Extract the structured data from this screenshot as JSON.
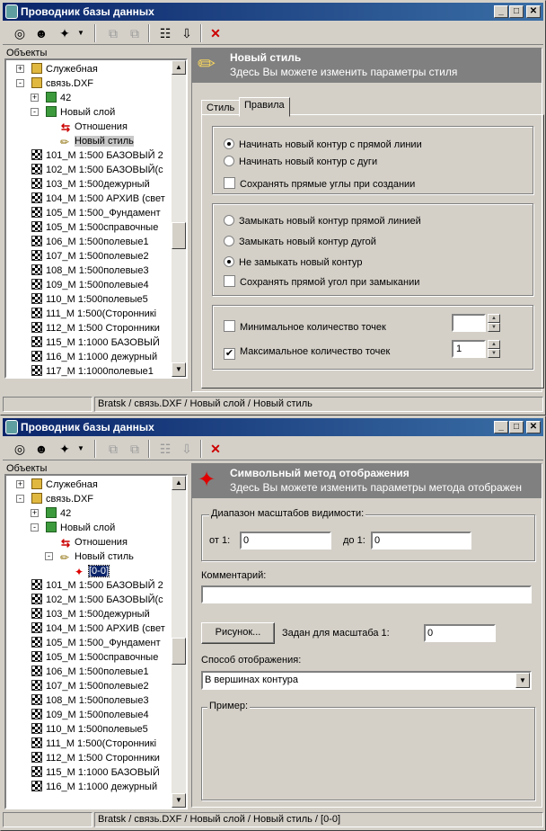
{
  "window_title": "Проводник базы данных",
  "objects_label": "Объекты",
  "toolbar_icons": [
    "connect-icon",
    "open-icon",
    "new-icon",
    "dropdown-icon",
    "copy-icon",
    "paste-icon",
    "properties-icon",
    "import-icon",
    "delete-icon"
  ],
  "top": {
    "tree": {
      "rows": [
        {
          "label": "Служебная",
          "icon": "folder",
          "level": 1,
          "exp": "+"
        },
        {
          "label": "связь.DXF",
          "icon": "folder",
          "level": 1,
          "exp": "-"
        },
        {
          "label": "42",
          "icon": "layer",
          "level": 2,
          "exp": "+"
        },
        {
          "label": "Новый слой",
          "icon": "layer",
          "level": 2,
          "exp": "-"
        },
        {
          "label": "Отношения",
          "icon": "rel",
          "level": 3,
          "exp": ""
        },
        {
          "label": "Новый стиль",
          "icon": "pen",
          "level": 3,
          "exp": "",
          "sel": true
        },
        {
          "label": "101_М 1:500 БАЗОВЫЙ 2",
          "icon": "net",
          "level": 1,
          "exp": ""
        },
        {
          "label": "102_М 1:500 БАЗОВЫЙ(с",
          "icon": "net",
          "level": 1,
          "exp": ""
        },
        {
          "label": "103_М 1:500дежурный",
          "icon": "net",
          "level": 1,
          "exp": ""
        },
        {
          "label": "104_М 1:500 АРХИВ (свет",
          "icon": "net",
          "level": 1,
          "exp": ""
        },
        {
          "label": "105_М 1:500_Фундамент",
          "icon": "net",
          "level": 1,
          "exp": ""
        },
        {
          "label": "105_М 1:500справочные",
          "icon": "net",
          "level": 1,
          "exp": ""
        },
        {
          "label": "106_М 1:500полевые1",
          "icon": "net",
          "level": 1,
          "exp": ""
        },
        {
          "label": "107_М 1:500полевые2",
          "icon": "net",
          "level": 1,
          "exp": ""
        },
        {
          "label": "108_М 1:500полевые3",
          "icon": "net",
          "level": 1,
          "exp": ""
        },
        {
          "label": "109_М 1:500полевые4",
          "icon": "net",
          "level": 1,
          "exp": ""
        },
        {
          "label": "110_М 1:500полевые5",
          "icon": "net",
          "level": 1,
          "exp": ""
        },
        {
          "label": "111_М 1:500(Сторонникі",
          "icon": "net",
          "level": 1,
          "exp": ""
        },
        {
          "label": "112_М 1:500 Сторонники",
          "icon": "net",
          "level": 1,
          "exp": ""
        },
        {
          "label": "115_М 1:1000 БАЗОВЫЙ",
          "icon": "net",
          "level": 1,
          "exp": ""
        },
        {
          "label": "116_М 1:1000 дежурный",
          "icon": "net",
          "level": 1,
          "exp": ""
        },
        {
          "label": "117_М 1:1000полевые1",
          "icon": "net",
          "level": 1,
          "exp": ""
        }
      ]
    },
    "header": {
      "title": "Новый стиль",
      "subtitle": "Здесь Вы можете изменить параметры стиля"
    },
    "tabs": [
      "Стиль",
      "Правила"
    ],
    "group1": {
      "opt1": "Начинать новый контур с прямой линии",
      "opt2": "Начинать новый контур с дуги",
      "chk": "Сохранять прямые углы при создании"
    },
    "group2": {
      "opt1": "Замыкать новый контур прямой линией",
      "opt2": "Замыкать новый контур дугой",
      "opt3": "Не замыкать новый контур",
      "chk": "Сохранять прямой угол при замыкании"
    },
    "group3": {
      "min_label": "Минимальное количество точек",
      "min_value": "",
      "max_label": "Максимальное количество точек",
      "max_value": "1"
    },
    "status_path": "Bratsk / связь.DXF / Новый слой / Новый стиль"
  },
  "bottom": {
    "tree": {
      "rows": [
        {
          "label": "Служебная",
          "icon": "folder",
          "level": 1,
          "exp": "+"
        },
        {
          "label": "связь.DXF",
          "icon": "folder",
          "level": 1,
          "exp": "-"
        },
        {
          "label": "42",
          "icon": "layer",
          "level": 2,
          "exp": "+"
        },
        {
          "label": "Новый слой",
          "icon": "layer",
          "level": 2,
          "exp": "-"
        },
        {
          "label": "Отношения",
          "icon": "rel",
          "level": 3,
          "exp": ""
        },
        {
          "label": "Новый стиль",
          "icon": "pen",
          "level": 3,
          "exp": "-"
        },
        {
          "label": "[0-0]",
          "icon": "star",
          "level": 4,
          "exp": "",
          "selblue": true
        },
        {
          "label": "101_М 1:500 БАЗОВЫЙ 2",
          "icon": "net",
          "level": 1,
          "exp": ""
        },
        {
          "label": "102_М 1:500 БАЗОВЫЙ(с",
          "icon": "net",
          "level": 1,
          "exp": ""
        },
        {
          "label": "103_М 1:500дежурный",
          "icon": "net",
          "level": 1,
          "exp": ""
        },
        {
          "label": "104_М 1:500 АРХИВ (свет",
          "icon": "net",
          "level": 1,
          "exp": ""
        },
        {
          "label": "105_М 1:500_Фундамент",
          "icon": "net",
          "level": 1,
          "exp": ""
        },
        {
          "label": "105_М 1:500справочные",
          "icon": "net",
          "level": 1,
          "exp": ""
        },
        {
          "label": "106_М 1:500полевые1",
          "icon": "net",
          "level": 1,
          "exp": ""
        },
        {
          "label": "107_М 1:500полевые2",
          "icon": "net",
          "level": 1,
          "exp": ""
        },
        {
          "label": "108_М 1:500полевые3",
          "icon": "net",
          "level": 1,
          "exp": ""
        },
        {
          "label": "109_М 1:500полевые4",
          "icon": "net",
          "level": 1,
          "exp": ""
        },
        {
          "label": "110_М 1:500полевые5",
          "icon": "net",
          "level": 1,
          "exp": ""
        },
        {
          "label": "111_М 1:500(Сторонникі",
          "icon": "net",
          "level": 1,
          "exp": ""
        },
        {
          "label": "112_М 1:500 Сторонники",
          "icon": "net",
          "level": 1,
          "exp": ""
        },
        {
          "label": "115_М 1:1000 БАЗОВЫЙ",
          "icon": "net",
          "level": 1,
          "exp": ""
        },
        {
          "label": "116_М 1:1000 дежурный",
          "icon": "net",
          "level": 1,
          "exp": ""
        }
      ]
    },
    "header": {
      "title": "Символьный метод отображения",
      "subtitle": "Здесь Вы можете изменить параметры метода отображен"
    },
    "range_group": "Диапазон масштабов видимости:",
    "from_label": "от 1:",
    "from_value": "0",
    "to_label": "до 1:",
    "to_value": "0",
    "comment_label": "Комментарий:",
    "comment_value": "",
    "picture_button": "Рисунок...",
    "scale_label": "Задан для масштаба 1:",
    "scale_value": "0",
    "display_label": "Способ отображения:",
    "display_value": "В вершинах контура",
    "example_label": "Пример:",
    "status_path": "Bratsk / связь.DXF / Новый слой / Новый стиль / [0-0]"
  }
}
